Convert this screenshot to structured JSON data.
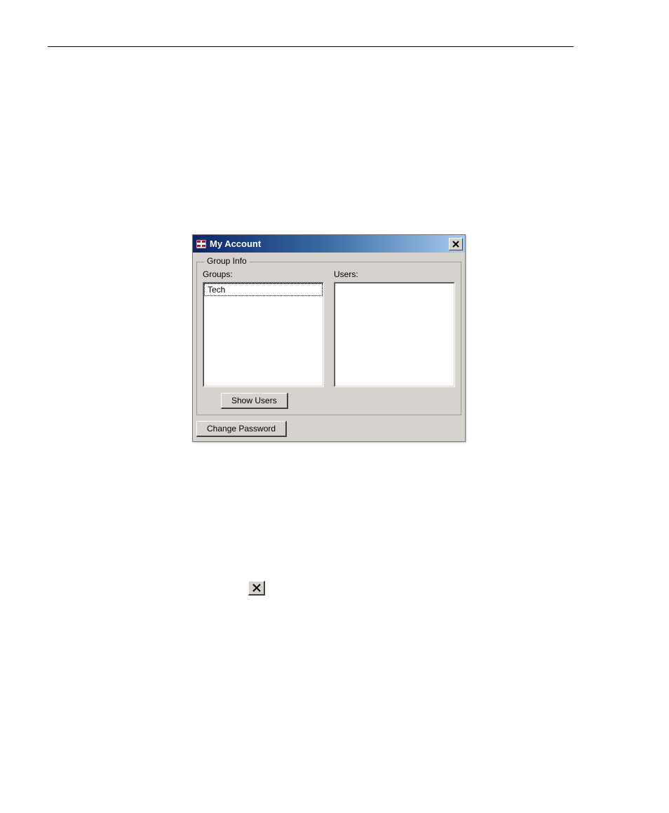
{
  "dialog": {
    "title": "My Account",
    "groupbox_legend": "Group Info",
    "groups_label": "Groups:",
    "users_label": "Users:",
    "groups_items": [
      "Tech"
    ],
    "show_users_label": "Show Users",
    "change_password_label": "Change Password",
    "close_glyph": "×"
  },
  "inline_close_glyph": "×"
}
